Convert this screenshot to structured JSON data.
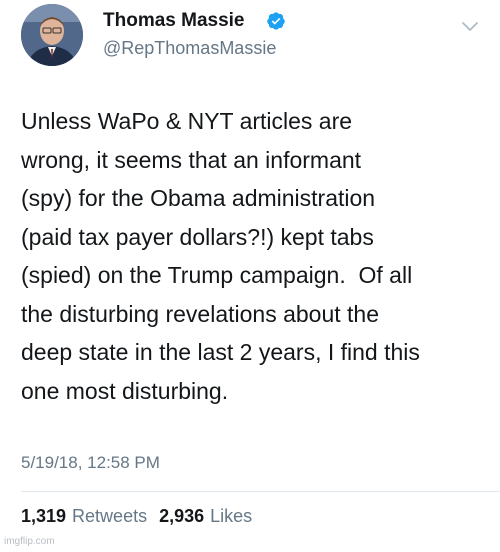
{
  "author": {
    "display_name": "Thomas Massie",
    "handle": "@RepThomasMassie",
    "verified": true,
    "avatar_icon": "profile-photo"
  },
  "tweet": {
    "text_lines": [
      "Unless WaPo & NYT articles are",
      "wrong, it seems that an informant",
      "(spy) for the Obama administration",
      "(paid tax payer dollars?!) kept tabs",
      "(spied) on the Trump campaign.  Of all",
      "the disturbing revelations about the",
      "deep state in the last 2 years, I find this",
      "one most disturbing."
    ],
    "timestamp": "5/19/18, 12:58 PM"
  },
  "stats": {
    "retweets_count": "1,319",
    "retweets_label": "Retweets",
    "likes_count": "2,936",
    "likes_label": "Likes"
  },
  "icons": {
    "verified": "verified-badge-icon",
    "more": "chevron-down-icon"
  },
  "colors": {
    "text": "#14171a",
    "secondary": "#657786",
    "verified_blue": "#1da1f2",
    "divider": "#e1e8ed"
  },
  "watermark": "imgflip.com"
}
